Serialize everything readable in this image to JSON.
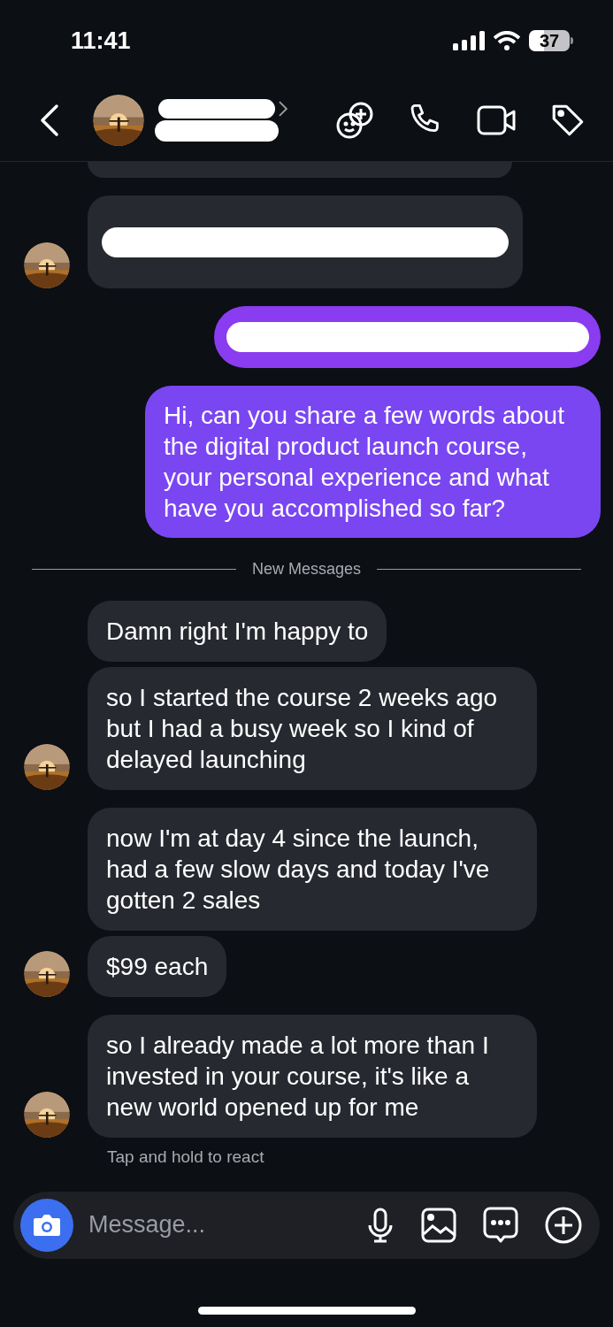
{
  "status_bar": {
    "time": "11:41",
    "battery": "37"
  },
  "header": {
    "name_redacted": true
  },
  "messages": [
    {
      "kind": "cut_received",
      "avatar": false
    },
    {
      "kind": "redacted_received",
      "avatar": true
    },
    {
      "kind": "redacted_sent"
    },
    {
      "kind": "sent",
      "text": "Hi, can you share a few words about the digital product launch course, your personal experience and what have you accomplished so far?"
    },
    {
      "kind": "divider",
      "text": "New Messages"
    },
    {
      "kind": "received",
      "text": "Damn right I'm happy to",
      "avatar": false
    },
    {
      "kind": "received",
      "text": "so I started the course 2 weeks ago but I had a busy week so I kind of delayed launching",
      "avatar": true
    },
    {
      "kind": "received",
      "text": "now I'm at day 4 since the launch, had a few slow days and today I've gotten 2 sales",
      "avatar": false
    },
    {
      "kind": "received",
      "text": "$99 each",
      "avatar": true
    },
    {
      "kind": "received",
      "text": "so I already made a lot more than I invested in your course, it's like a new world opened up for me",
      "avatar": true
    }
  ],
  "hint": "Tap and hold to react",
  "composer": {
    "placeholder": "Message..."
  }
}
